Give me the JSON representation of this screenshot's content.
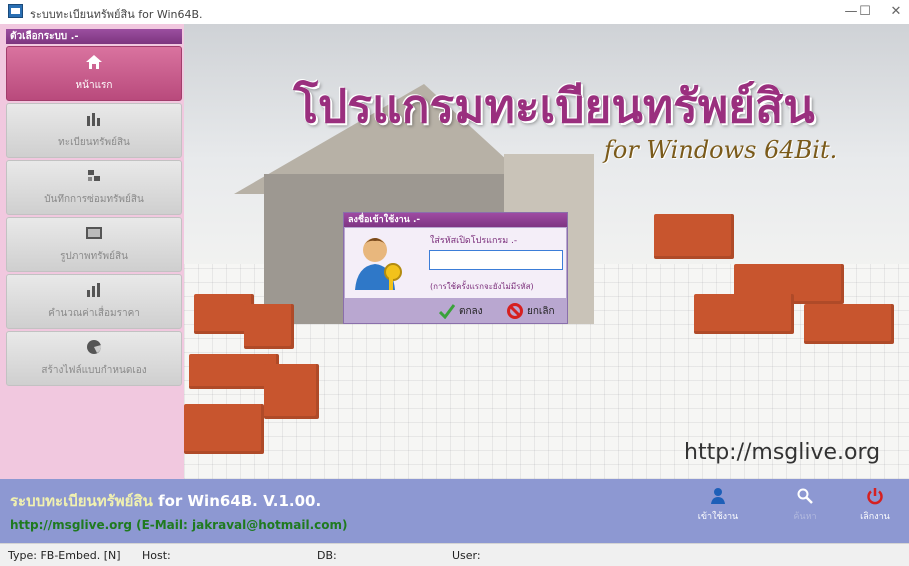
{
  "window": {
    "title": "ระบบทะเบียนทรัพย์สิน for Win64B.",
    "minimize_glyph": "—",
    "maximize_glyph": "☐",
    "close_glyph": "✕"
  },
  "sidebar": {
    "header": "ตัวเลือกระบบ .-",
    "items": [
      {
        "label": "หน้าแรก",
        "icon": "home-icon",
        "active": true
      },
      {
        "label": "ทะเบียนทรัพย์สิน",
        "icon": "register-icon",
        "active": false
      },
      {
        "label": "บันทึกการซ่อมทรัพย์สิน",
        "icon": "repair-icon",
        "active": false
      },
      {
        "label": "รูปภาพทรัพย์สิน",
        "icon": "picture-icon",
        "active": false
      },
      {
        "label": "คำนวณค่าเสื่อมราคา",
        "icon": "chart-icon",
        "active": false
      },
      {
        "label": "สร้างไฟล์แบบกำหนดเอง",
        "icon": "custom-file-icon",
        "active": false
      }
    ]
  },
  "hero": {
    "title": "โปรแกรมทะเบียนทรัพย์สิน",
    "subtitle": "for Windows 64Bit.",
    "url": "http://msglive.org"
  },
  "login_dialog": {
    "title": "ลงชื่อเข้าใช้งาน .-",
    "password_label": "ใส่รหัสเปิดโปรแกรม .-",
    "password_value": "",
    "hint": "(การใช้ครั้งแรกจะยังไม่มีรหัส)",
    "ok_label": "ตกลง",
    "cancel_label": "ยกเลิก"
  },
  "footer": {
    "title_thai": "ระบบทะเบียนทรัพย์สิน",
    "title_version": "for Win64B. V.1.00.",
    "link": "http://msglive.org (E-Mail: jakraval@hotmail.com)",
    "buttons": [
      {
        "label": "เข้าใช้งาน",
        "icon": "user-icon"
      },
      {
        "label": "ค้นหา",
        "icon": "search-icon"
      },
      {
        "label": "เลิกงาน",
        "icon": "power-icon"
      }
    ]
  },
  "statusbar": {
    "type": "Type: FB-Embed. [N]",
    "host": "Host:",
    "db": "DB:",
    "user": "User:"
  },
  "colors": {
    "accent": "#9a2f7e",
    "footer_bg": "#8d98d2",
    "sidebar_bg": "#f1c8df"
  }
}
